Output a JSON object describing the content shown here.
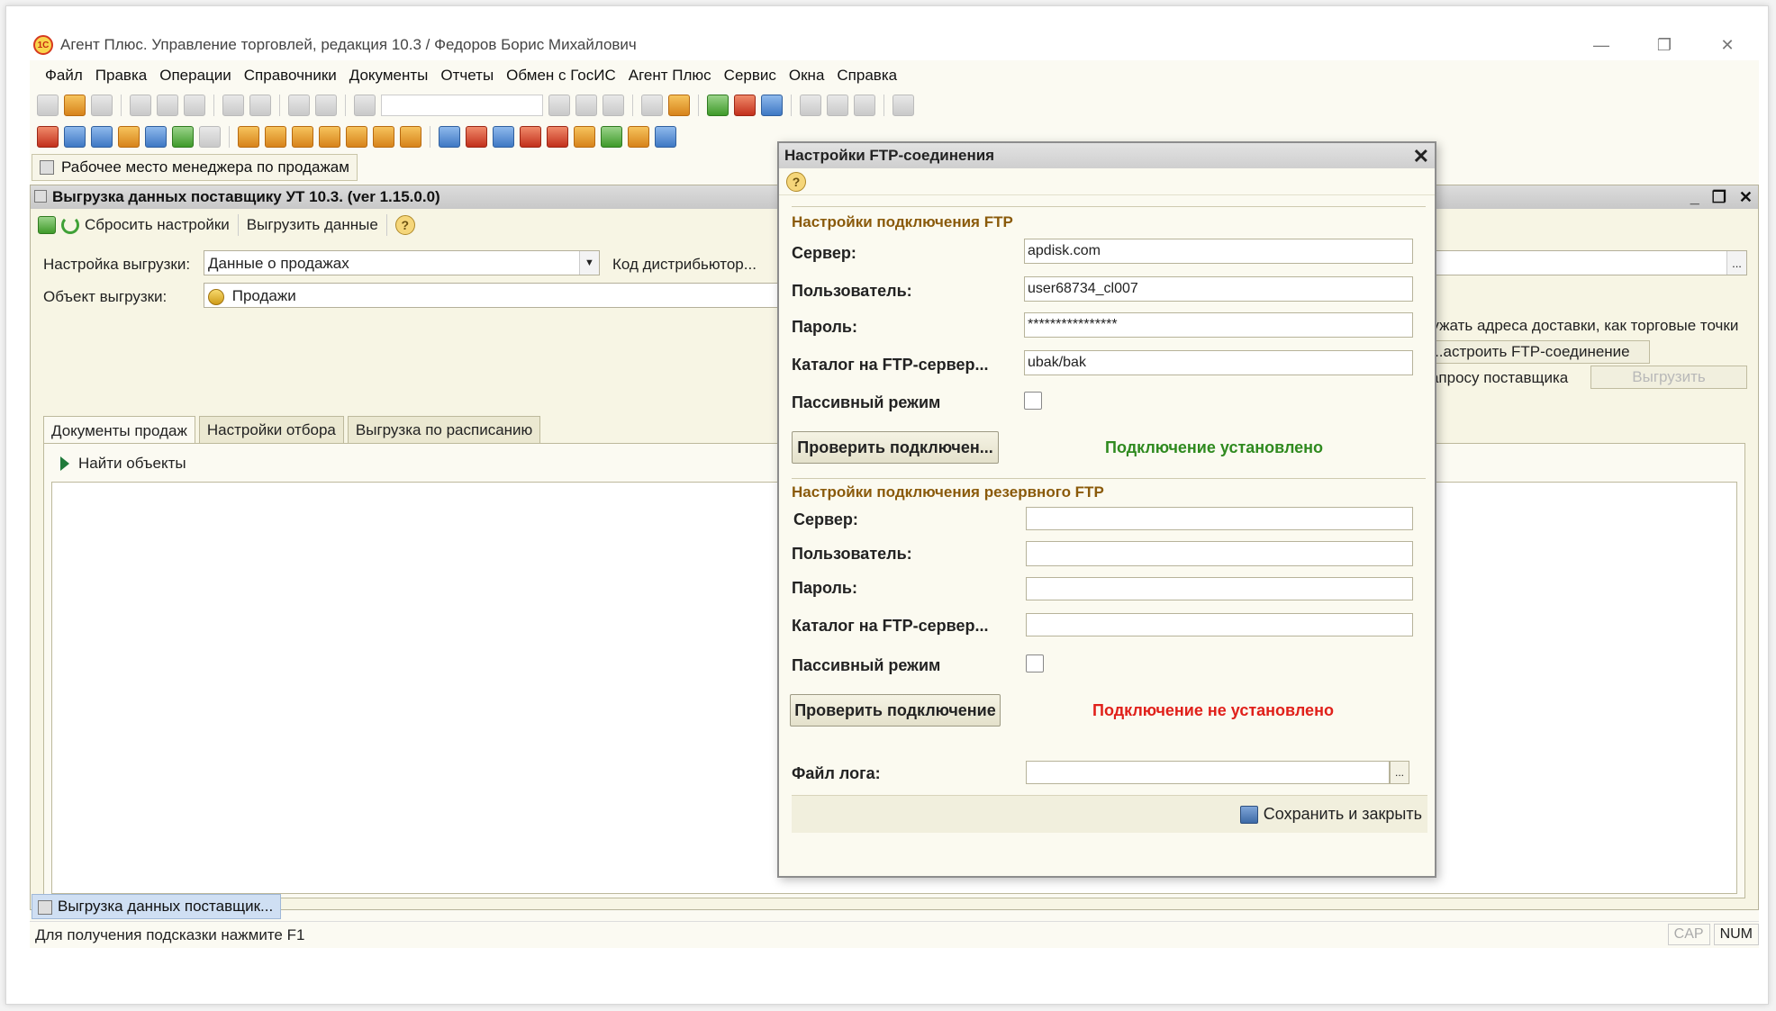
{
  "window": {
    "title": "Агент Плюс. Управление торговлей, редакция 10.3 / Федоров Борис Михайлович",
    "app_icon": "1c-logo-icon"
  },
  "menu": [
    "Файл",
    "Правка",
    "Операции",
    "Справочники",
    "Документы",
    "Отчеты",
    "Обмен с ГосИС",
    "Агент Плюс",
    "Сервис",
    "Окна",
    "Справка"
  ],
  "workplace_tab": "Рабочее место менеджера по продажам",
  "child": {
    "title": "Выгрузка данных поставщику УТ 10.3. (ver 1.15.0.0)",
    "toolbar": {
      "reset": "Сбросить настройки",
      "export": "Выгрузить данные"
    },
    "settings_label": "Настройка выгрузки:",
    "settings_value": "Данные о продажах",
    "distributor_label": "Код дистрибьютор...",
    "object_label": "Объект выгрузки:",
    "object_value": "Продажи",
    "addresses_text": "...ружать адреса доставки, как торговые точки",
    "ftp_button": "...астроить FTP-соединение",
    "request_text": "...запросу поставщика",
    "export_button": "Выгрузить",
    "tabs": [
      "Документы продаж",
      "Настройки отбора",
      "Выгрузка по расписанию"
    ],
    "find_objects": "Найти объекты"
  },
  "taskbar_tab": "Выгрузка данных поставщик...",
  "status": {
    "hint": "Для получения подсказки нажмите F1",
    "cap": "CAP",
    "num": "NUM"
  },
  "dialog": {
    "title": "Настройки FTP-соединения",
    "primary": {
      "section": "Настройки подключения FTP",
      "server_label": "Сервер:",
      "server_value": "apdisk.com",
      "user_label": "Пользователь:",
      "user_value": "user68734_cl007",
      "password_label": "Пароль:",
      "password_value": "****************",
      "catalog_label": "Каталог на FTP-сервер...",
      "catalog_value": "ubak/bak",
      "passive_label": "Пассивный режим",
      "check_button": "Проверить подключен...",
      "status": "Подключение установлено"
    },
    "backup": {
      "section": "Настройки подключения резервного FTP",
      "server_label": "Сервер:",
      "server_value": "",
      "user_label": "Пользователь:",
      "user_value": "",
      "password_label": "Пароль:",
      "password_value": "",
      "catalog_label": "Каталог на FTP-сервер...",
      "catalog_value": "",
      "passive_label": "Пассивный режим",
      "check_button": "Проверить подключение",
      "status": "Подключение не установлено"
    },
    "log_label": "Файл лога:",
    "log_value": "",
    "ellipsis": "...",
    "save_button": "Сохранить и закрыть"
  }
}
